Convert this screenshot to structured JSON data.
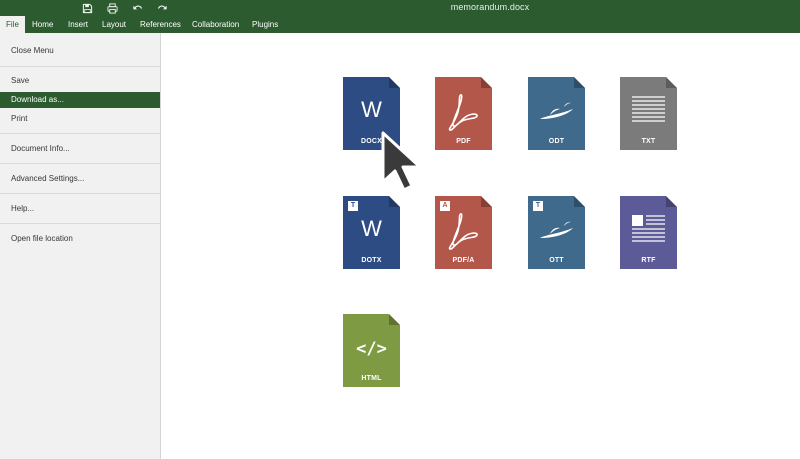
{
  "window": {
    "title": "memorandum.docx"
  },
  "quick_access": [
    {
      "icon": "save-icon"
    },
    {
      "icon": "print-icon"
    },
    {
      "icon": "undo-icon"
    },
    {
      "icon": "redo-icon"
    }
  ],
  "tabs": [
    {
      "label": "File",
      "active": true
    },
    {
      "label": "Home"
    },
    {
      "label": "Insert"
    },
    {
      "label": "Layout"
    },
    {
      "label": "References"
    },
    {
      "label": "Collaboration"
    },
    {
      "label": "Plugins"
    }
  ],
  "file_menu": {
    "items": [
      {
        "label": "Close Menu"
      },
      {
        "label": "Save"
      },
      {
        "label": "Download as...",
        "active": true
      },
      {
        "label": "Print"
      },
      {
        "label": "Document Info..."
      },
      {
        "label": "Advanced Settings..."
      },
      {
        "label": "Help..."
      },
      {
        "label": "Open file location"
      }
    ]
  },
  "formats": [
    {
      "label": "DOCX",
      "color": "#2d4c84",
      "icon": "word-icon"
    },
    {
      "label": "PDF",
      "color": "#b3574a",
      "icon": "pdf-icon"
    },
    {
      "label": "ODT",
      "color": "#3f6a8c",
      "icon": "odt-icon"
    },
    {
      "label": "TXT",
      "color": "#7b7b7b",
      "icon": "txt-icon"
    },
    {
      "label": "DOTX",
      "color": "#2d4c84",
      "icon": "word-icon",
      "template_badge": "T"
    },
    {
      "label": "PDF/A",
      "color": "#b3574a",
      "icon": "pdf-icon",
      "template_badge": "A"
    },
    {
      "label": "OTT",
      "color": "#3f6a8c",
      "icon": "odt-icon",
      "template_badge": "T"
    },
    {
      "label": "RTF",
      "color": "#5d5a98",
      "icon": "rtf-icon"
    },
    {
      "label": "HTML",
      "color": "#7e9a43",
      "icon": "html-icon"
    }
  ],
  "glyph_text": {
    "word": "W",
    "html": "</>"
  },
  "colors": {
    "brand": "#2b5b2e",
    "menu_bg": "#f1f1f1"
  }
}
